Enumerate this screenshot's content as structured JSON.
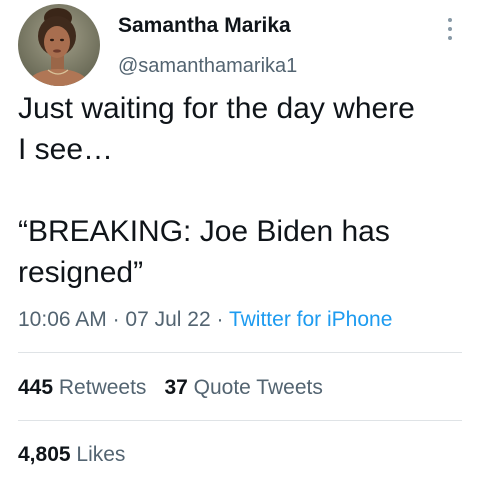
{
  "author": {
    "display_name": "Samantha Marika",
    "handle": "@samanthamarika1"
  },
  "tweet": {
    "lines": [
      "Just waiting for the day where",
      "I see…",
      "",
      "“BREAKING: Joe Biden has",
      "resigned”"
    ],
    "time": "10:06 AM",
    "separator": "·",
    "date": "07 Jul 22",
    "source": "Twitter for iPhone"
  },
  "stats": {
    "retweets_count": "445",
    "retweets_label": "Retweets",
    "quote_tweets_count": "37",
    "quote_tweets_label": "Quote Tweets",
    "likes_count": "4,805",
    "likes_label": "Likes"
  },
  "icons": {
    "more": "more-vertical-icon",
    "avatar": "profile-photo"
  },
  "colors": {
    "text": "#0f1419",
    "secondary": "#536471",
    "link": "#1d9bf0",
    "divider": "#dfe3e6"
  }
}
